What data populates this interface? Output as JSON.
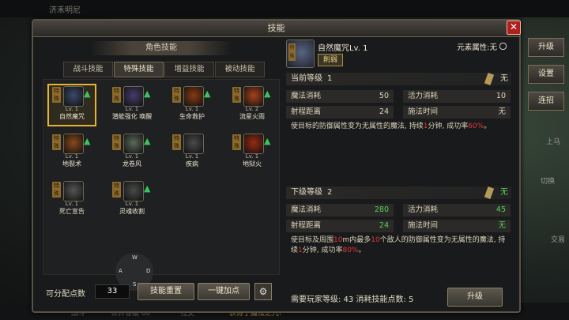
{
  "dialog": {
    "title": "技能",
    "close_label": "✕",
    "section_title": "角色技能",
    "tabs": [
      {
        "label": "战斗技能",
        "active": false
      },
      {
        "label": "特殊技能",
        "active": true
      },
      {
        "label": "增益技能",
        "active": false
      },
      {
        "label": "被动技能",
        "active": false
      }
    ],
    "tag_text": "特殊",
    "skills": [
      {
        "level": "Lv. 1",
        "name": "自然魔咒",
        "selected": true,
        "upgradable": true,
        "icon": "skull-spell-icon",
        "color": "#3a4a6a"
      },
      {
        "level": "Lv. 1",
        "name": "潜能强化 唤醒",
        "selected": false,
        "upgradable": true,
        "icon": "mage-icon",
        "color": "#4a3b6a"
      },
      {
        "level": "Lv. 1",
        "name": "生命救护",
        "selected": false,
        "upgradable": true,
        "icon": "fire-spiral-icon",
        "color": "#8a3a12"
      },
      {
        "level": "Lv. 2",
        "name": "流星火雨",
        "selected": false,
        "upgradable": true,
        "icon": "meteor-icon",
        "color": "#a8421a"
      },
      {
        "level": "Lv. 1",
        "name": "地裂术",
        "selected": false,
        "upgradable": true,
        "icon": "earth-spike-icon",
        "color": "#8a4a1a"
      },
      {
        "level": "Lv. 1",
        "name": "龙卷风",
        "selected": false,
        "upgradable": true,
        "icon": "tornado-icon",
        "color": "#5a6a5a"
      },
      {
        "level": "Lv. 1",
        "name": "疾病",
        "selected": false,
        "upgradable": false,
        "icon": "disease-icon",
        "color": "#4a4a4a"
      },
      {
        "level": "Lv. 1",
        "name": "地狱火",
        "selected": false,
        "upgradable": true,
        "icon": "hellfire-icon",
        "color": "#9a2a12"
      },
      {
        "level": "Lv. 1",
        "name": "死亡宣告",
        "selected": false,
        "upgradable": false,
        "icon": "death-icon",
        "color": "#555555"
      },
      {
        "level": "Lv. 1",
        "name": "灵魂收割",
        "selected": false,
        "upgradable": true,
        "icon": "reaper-icon",
        "color": "#4a4a4a"
      }
    ],
    "dpad": {
      "w": "W",
      "a": "A",
      "s": "S",
      "d": "D"
    },
    "points_label": "可分配点数",
    "points_value": "33",
    "reset_label": "技能重置",
    "auto_label": "一键加点",
    "detail": {
      "name": "自然魔咒Lv. 1",
      "element": "元素属性:无",
      "badge": "削弱",
      "current": {
        "title": "当前等级",
        "level": "1",
        "status": "无",
        "mana_label": "魔法消耗",
        "mana": "50",
        "stamina_label": "活力消耗",
        "stamina": "10",
        "range_label": "射程距离",
        "range": "24",
        "cast_label": "施法时间",
        "cast": "无",
        "desc_a": "使目标的防御属性变为无属性的魔法, 持续",
        "duration": "1",
        "desc_b": "分钟, 成功率",
        "rate": "60%",
        "desc_c": "。"
      },
      "next": {
        "title": "下级等级",
        "level": "2",
        "status": "无",
        "mana_label": "魔法消耗",
        "mana": "280",
        "stamina_label": "活力消耗",
        "stamina": "45",
        "range_label": "射程距离",
        "range": "24",
        "cast_label": "施法时间",
        "cast": "无",
        "desc_a": "使目标及周围",
        "radius": "10",
        "desc_b": "m内最多",
        "count": "10",
        "desc_c": "个敌人的防御属性变为无属性的魔法, 持续",
        "duration": "1",
        "desc_d": "分钟, 成功率",
        "rate": "80%",
        "desc_e": "。"
      },
      "requirement": "需要玩家等级: 43 消耗技能点数: 5",
      "upgrade_label": "升级"
    }
  },
  "side": {
    "upgrade": "升级",
    "settings": "设置",
    "grab": "连招"
  },
  "background": {
    "top_text": "济禾明尼",
    "bottom": [
      "战斗",
      "世界等级 60",
      "社交",
      "获得了魔法之咒!"
    ],
    "right_a": "上马",
    "right_b": "切换",
    "right_c": "交易"
  },
  "colors": {
    "accent": "#e5b432",
    "upgrade_arrow": "#39c65a",
    "highlight_red": "#e33838",
    "highlight_green": "#58d35a"
  }
}
